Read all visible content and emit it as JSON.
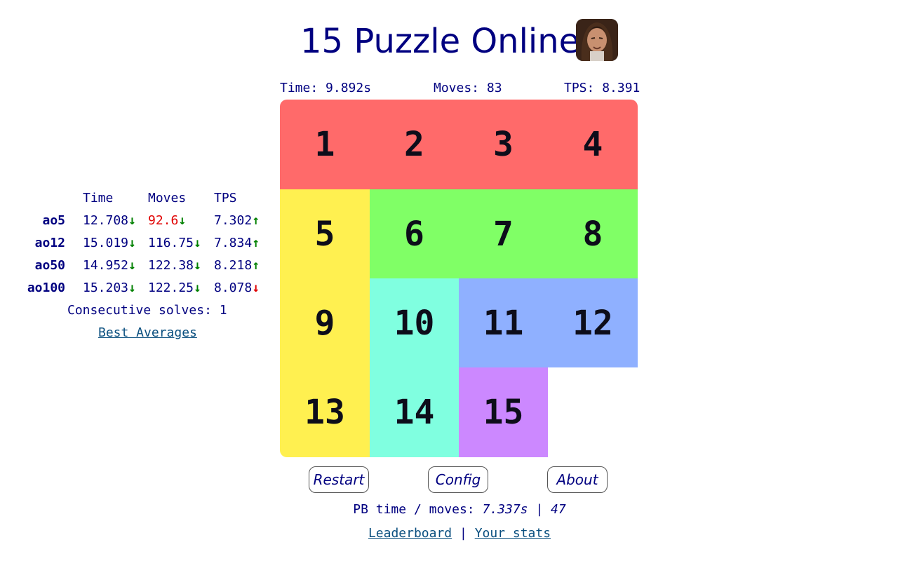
{
  "header": {
    "title": "15 Puzzle Online"
  },
  "stats_bar": {
    "time_label": "Time:",
    "time_value": "9.892s",
    "moves_label": "Moves:",
    "moves_value": "83",
    "tps_label": "TPS:",
    "tps_value": "8.391"
  },
  "colors": {
    "row1": "#ff6a6a",
    "col1": "#fff050",
    "row2": "#80ff66",
    "col2": "#80ffe0",
    "row3": "#8fb0ff",
    "tile15": "#cc88ff",
    "text": "#000080",
    "link": "#0a4f7f",
    "good_arrow": "#008000",
    "bad": "#e00000"
  },
  "board": {
    "tiles": [
      {
        "n": "1"
      },
      {
        "n": "2"
      },
      {
        "n": "3"
      },
      {
        "n": "4"
      },
      {
        "n": "5"
      },
      {
        "n": "6"
      },
      {
        "n": "7"
      },
      {
        "n": "8"
      },
      {
        "n": "9"
      },
      {
        "n": "10"
      },
      {
        "n": "11"
      },
      {
        "n": "12"
      },
      {
        "n": "13"
      },
      {
        "n": "14"
      },
      {
        "n": "15"
      }
    ],
    "empty_position": "bottom-right"
  },
  "averages": {
    "headers": {
      "time": "Time",
      "moves": "Moves",
      "tps": "TPS"
    },
    "rows": [
      {
        "label": "ao5",
        "time": "12.708",
        "time_arrow": "↓",
        "moves": "92.6",
        "moves_arrow": "↓",
        "tps": "7.302",
        "tps_arrow": "↑"
      },
      {
        "label": "ao12",
        "time": "15.019",
        "time_arrow": "↓",
        "moves": "116.75",
        "moves_arrow": "↓",
        "tps": "7.834",
        "tps_arrow": "↑"
      },
      {
        "label": "ao50",
        "time": "14.952",
        "time_arrow": "↓",
        "moves": "122.38",
        "moves_arrow": "↓",
        "tps": "8.218",
        "tps_arrow": "↑"
      },
      {
        "label": "ao100",
        "time": "15.203",
        "time_arrow": "↓",
        "moves": "122.25",
        "moves_arrow": "↓",
        "tps": "8.078",
        "tps_arrow": "↓"
      }
    ],
    "consecutive_label": "Consecutive solves:",
    "consecutive_value": "1",
    "best_averages_link": "Best Averages"
  },
  "buttons": {
    "restart": "Restart",
    "config": "Config",
    "about": "About"
  },
  "pb": {
    "label": "PB time / moves:",
    "time": "7.337s",
    "separator": "|",
    "moves": "47"
  },
  "footer": {
    "leaderboard": "Leaderboard",
    "separator": "|",
    "your_stats": "Your stats"
  }
}
